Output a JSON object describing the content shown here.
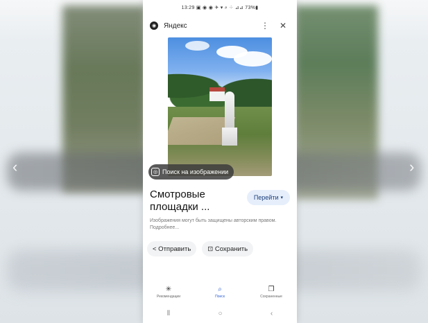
{
  "status_bar": {
    "text": "13:29 ▣ ◉ ◉ ✈ ▾ ⌕ ⁘ ⊿⊿ 73%▮"
  },
  "header": {
    "title": "Яндекс",
    "logo_icon": "yandex-logo-icon",
    "menu_icon": "⋮",
    "close_icon": "✕"
  },
  "image": {
    "overlay_label": "Поиск на изображении",
    "overlay_icon": "lens-icon"
  },
  "result": {
    "title": "Смотровые площадки ...",
    "go_button_label": "Перейти",
    "disclaimer": "Изображения могут быть защищены авторским правом. Подробнее..."
  },
  "actions": {
    "share_label": "< Отправить",
    "save_label": "⊡ Сохранить"
  },
  "bottom_nav": {
    "items": [
      {
        "label": "Рекомендации",
        "icon": "✳"
      },
      {
        "label": "Поиск",
        "icon": "⌕"
      },
      {
        "label": "Сохраненные",
        "icon": "❐"
      }
    ]
  },
  "system_nav": {
    "recent": "⦀",
    "home": "○",
    "back": "‹"
  },
  "side_nav": {
    "prev": "‹",
    "next": "›"
  },
  "colors": {
    "accent": "#2d5fd0",
    "go_button_bg": "#e6eefb"
  }
}
